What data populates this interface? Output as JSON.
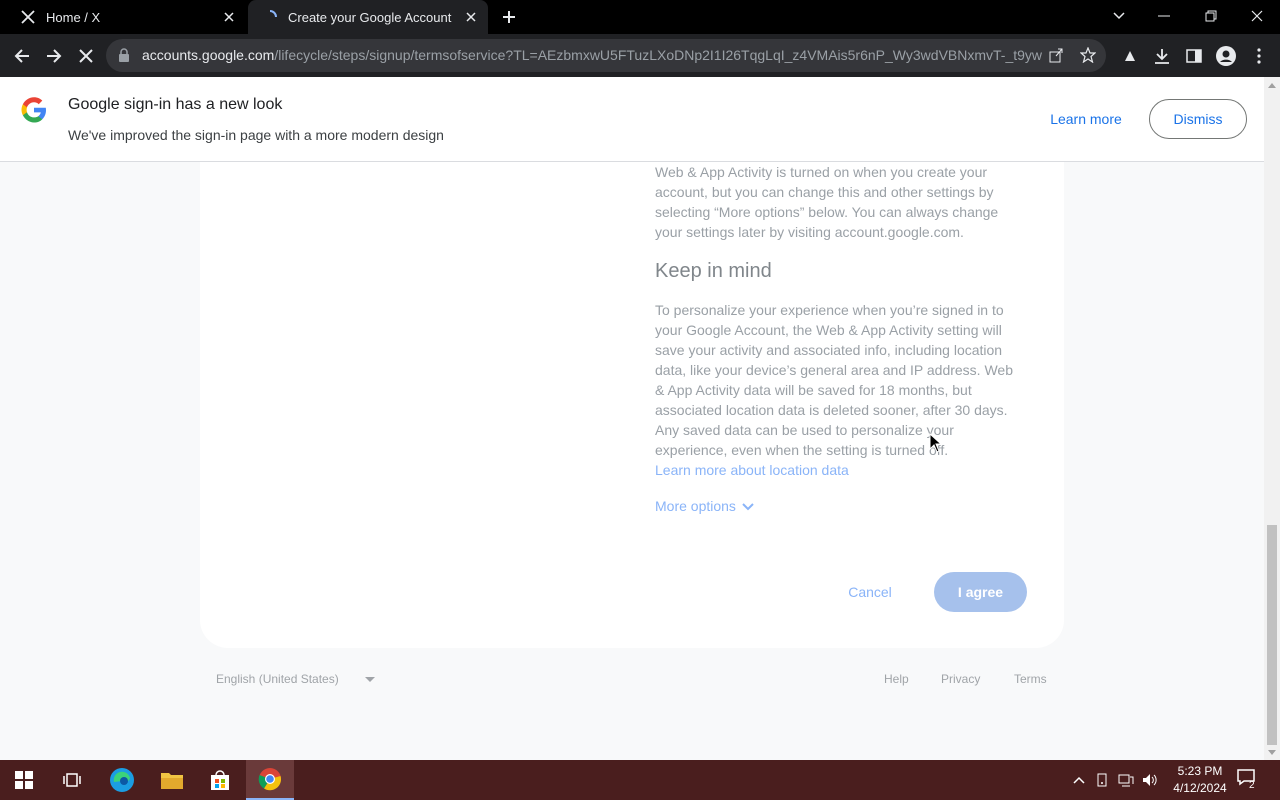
{
  "browser": {
    "tabs": [
      {
        "title": "Home / X",
        "icon": "x-logo-icon",
        "active": false
      },
      {
        "title": "Create your Google Account",
        "icon": "loading-spinner-icon",
        "active": true
      }
    ],
    "url_host": "accounts.google.com",
    "url_path": "/lifecycle/steps/signup/termsofservice?TL=AEzbmxwU5FTuzLXoDNp2I1I26TqgLqI_z4VMAis5r6nP_Wy3wdVBNxmvT-_t9ywR..."
  },
  "notice": {
    "title": "Google sign-in has a new look",
    "subtitle": "We've improved the sign-in page with a more modern design",
    "learn_more": "Learn more",
    "dismiss": "Dismiss"
  },
  "content": {
    "intro_text": "Web & App Activity is turned on when you create your account, but you can change this and other settings by selecting “More options” below. You can always change your settings later by visiting account.google.com.",
    "keep_in_mind_heading": "Keep in mind",
    "keep_in_mind_text": "To personalize your experience when you’re signed in to your Google Account, the Web & App Activity setting will save your activity and associated info, including location data, like your device’s general area and IP address. Web & App Activity data will be saved for 18 months, but associated location data is deleted sooner, after 30 days. Any saved data can be used to personalize your experience, even when the setting is turned off.",
    "location_link": "Learn more about location data",
    "more_options": "More options",
    "cancel": "Cancel",
    "agree": "I agree"
  },
  "footer": {
    "language": "English (United States)",
    "help": "Help",
    "privacy": "Privacy",
    "terms": "Terms"
  },
  "taskbar": {
    "time": "5:23 PM",
    "date": "4/12/2024",
    "notification_count": "2"
  },
  "colors": {
    "link": "#1a73e8",
    "faded_link": "#8ab4f8",
    "agree_button": "#a6c1ec",
    "taskbar": "#4a1e1e"
  }
}
